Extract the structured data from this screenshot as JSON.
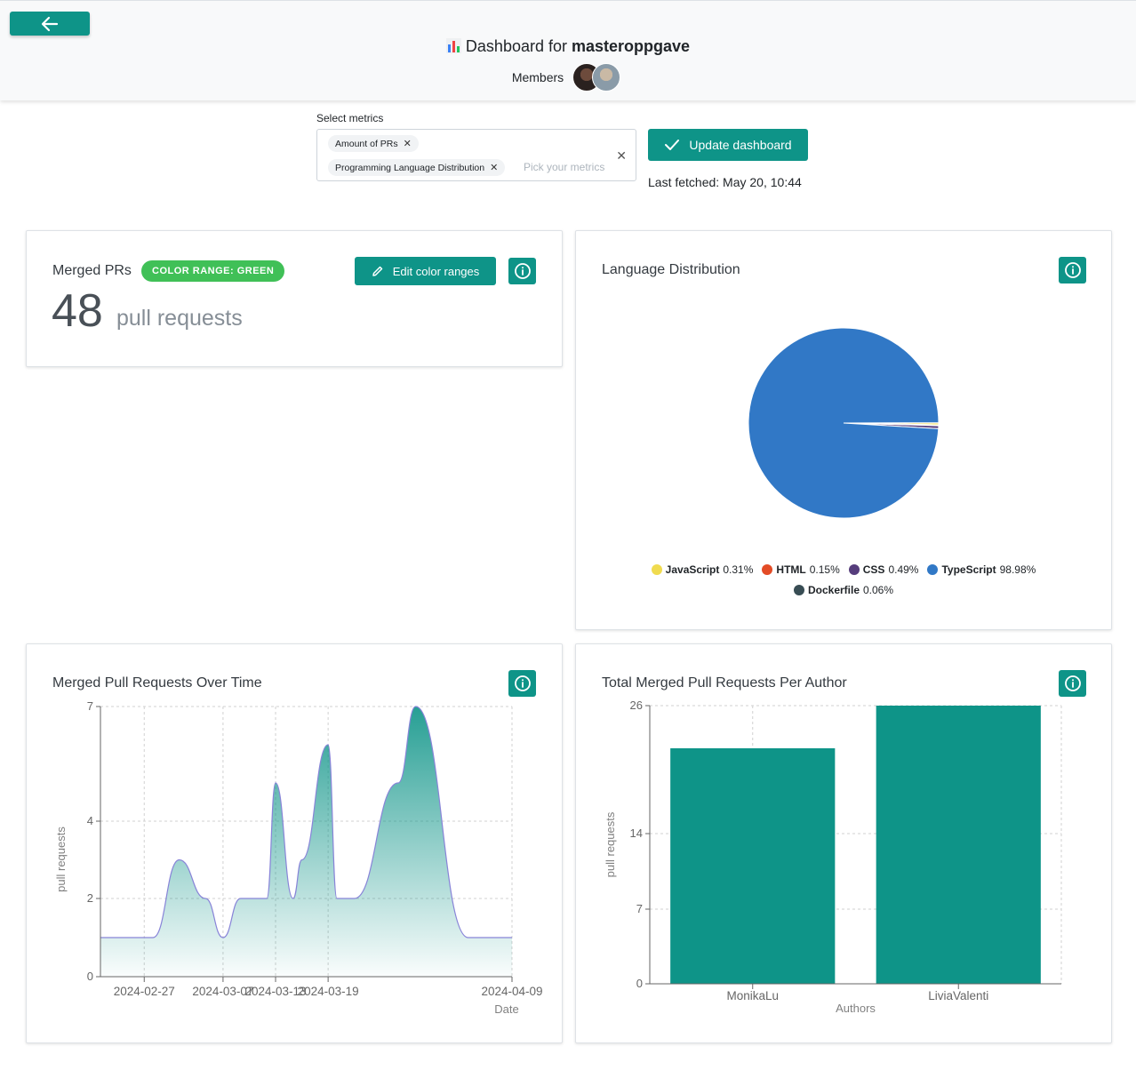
{
  "header": {
    "back_icon": "arrow-left-icon",
    "title_prefix": "Dashboard for",
    "project_name": "masteroppgave",
    "members_label": "Members"
  },
  "metrics": {
    "label": "Select metrics",
    "selected": [
      "Amount of PRs",
      "Programming Language Distribution"
    ],
    "placeholder": "Pick your metrics",
    "update_label": "Update dashboard",
    "last_fetched": "Last fetched: May 20, 10:44"
  },
  "merged_prs_card": {
    "title": "Merged PRs",
    "badge": "COLOR RANGE: GREEN",
    "edit_label": "Edit color ranges",
    "count": "48",
    "unit": "pull requests"
  },
  "language_card": {
    "title": "Language Distribution"
  },
  "over_time_card": {
    "title": "Merged Pull Requests Over Time"
  },
  "per_author_card": {
    "title": "Total Merged Pull Requests Per Author"
  },
  "colors": {
    "accent": "#0e9488",
    "badge_green": "#40c057",
    "javascript": "#f0db4f",
    "html": "#e34c26",
    "css": "#563d7c",
    "typescript": "#3178c6",
    "dockerfile": "#384d54"
  },
  "chart_data": [
    {
      "type": "pie",
      "title": "Language Distribution",
      "slices": [
        {
          "name": "JavaScript",
          "value": 0.31,
          "label": "0.31%",
          "color": "#f0db4f"
        },
        {
          "name": "HTML",
          "value": 0.15,
          "label": "0.15%",
          "color": "#e34c26"
        },
        {
          "name": "CSS",
          "value": 0.49,
          "label": "0.49%",
          "color": "#563d7c"
        },
        {
          "name": "TypeScript",
          "value": 98.98,
          "label": "98.98%",
          "color": "#3178c6"
        },
        {
          "name": "Dockerfile",
          "value": 0.06,
          "label": "0.06%",
          "color": "#384d54"
        }
      ]
    },
    {
      "type": "area",
      "title": "Merged Pull Requests Over Time",
      "xlabel": "Date",
      "ylabel": "pull requests",
      "x": [
        "2024-02-22",
        "2024-02-25",
        "2024-02-28",
        "2024-03-02",
        "2024-03-05",
        "2024-03-07",
        "2024-03-09",
        "2024-03-11",
        "2024-03-12",
        "2024-03-13",
        "2024-03-15",
        "2024-03-16",
        "2024-03-19",
        "2024-03-20",
        "2024-03-22",
        "2024-03-27",
        "2024-03-29",
        "2024-04-04",
        "2024-04-09"
      ],
      "values": [
        1,
        1,
        1,
        3,
        2,
        1,
        2,
        2,
        2,
        5,
        2,
        3,
        6,
        2,
        2,
        5,
        7,
        1,
        1
      ],
      "x_ticks": [
        "2024-02-27",
        "2024-03-07",
        "2024-03-13",
        "2024-03-19",
        "2024-04-09"
      ],
      "y_ticks": [
        0,
        2,
        4,
        7
      ],
      "ylim": [
        0,
        7
      ],
      "grid": true
    },
    {
      "type": "bar",
      "title": "Total Merged Pull Requests Per Author",
      "xlabel": "Authors",
      "ylabel": "pull requests",
      "categories": [
        "MonikaLu",
        "LiviaValenti"
      ],
      "values": [
        22,
        26
      ],
      "y_ticks": [
        0,
        7,
        14,
        26
      ],
      "ylim": [
        0,
        26
      ],
      "grid": true
    }
  ]
}
